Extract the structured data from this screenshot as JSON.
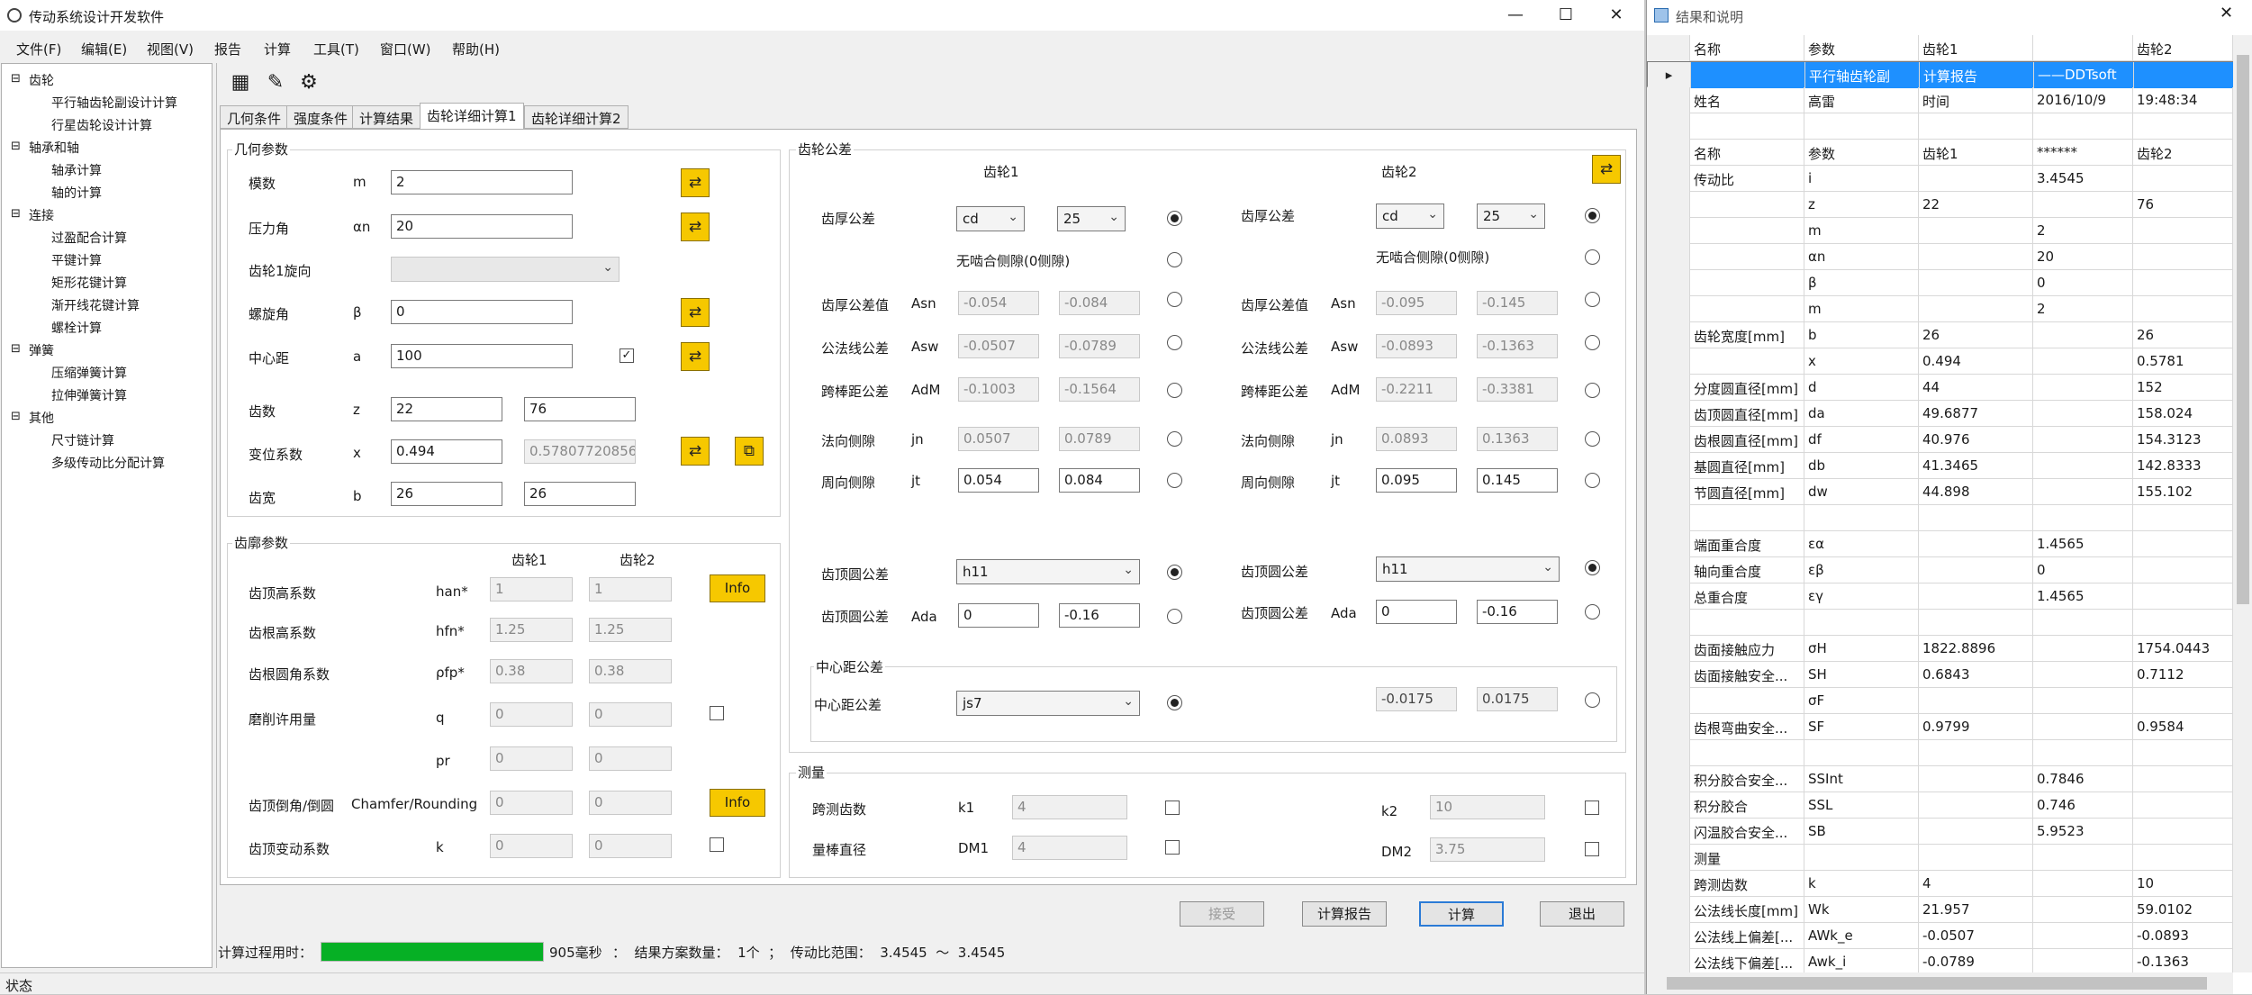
{
  "app": {
    "title": "传动系统设计开发软件"
  },
  "menu": [
    "文件(F)",
    "编辑(E)",
    "视图(V)",
    "报告",
    "计算",
    "工具(T)",
    "窗口(W)",
    "帮助(H)"
  ],
  "tree": {
    "groups": [
      {
        "label": "齿轮",
        "children": [
          "平行轴齿轮副设计计算",
          "行星齿轮设计计算"
        ]
      },
      {
        "label": "轴承和轴",
        "children": [
          "轴承计算",
          "轴的计算"
        ]
      },
      {
        "label": "连接",
        "children": [
          "过盈配合计算",
          "平键计算",
          "矩形花键计算",
          "渐开线花键计算",
          "螺栓计算"
        ]
      },
      {
        "label": "弹簧",
        "children": [
          "压缩弹簧计算",
          "拉伸弹簧计算"
        ]
      },
      {
        "label": "其他",
        "children": [
          "尺寸链计算",
          "多级传动比分配计算"
        ]
      }
    ]
  },
  "tabs": [
    "几何条件",
    "强度条件",
    "计算结果",
    "齿轮详细计算1",
    "齿轮详细计算2"
  ],
  "geom": {
    "title": "几何参数",
    "modulus": {
      "label": "模数",
      "sym": "m",
      "val": "2"
    },
    "pressure": {
      "label": "压力角",
      "sym": "αn",
      "val": "20"
    },
    "direction": {
      "label": "齿轮1旋向"
    },
    "helix": {
      "label": "螺旋角",
      "sym": "β",
      "val": "0"
    },
    "center": {
      "label": "中心距",
      "sym": "a",
      "val": "100"
    },
    "teeth": {
      "label": "齿数",
      "sym": "z",
      "v1": "22",
      "v2": "76"
    },
    "shift": {
      "label": "变位系数",
      "sym": "x",
      "v1": "0.494",
      "v2": "0.578077208561"
    },
    "width": {
      "label": "齿宽",
      "sym": "b",
      "v1": "26",
      "v2": "26"
    }
  },
  "profile": {
    "title": "齿廓参数",
    "h1": "齿轮1",
    "h2": "齿轮2",
    "rows": [
      {
        "label": "齿顶高系数",
        "sym": "han*",
        "v1": "1",
        "v2": "1"
      },
      {
        "label": "齿根高系数",
        "sym": "hfn*",
        "v1": "1.25",
        "v2": "1.25"
      },
      {
        "label": "齿根圆角系数",
        "sym": "ρfp*",
        "v1": "0.38",
        "v2": "0.38"
      },
      {
        "label": "磨削许用量",
        "sym": "q",
        "v1": "0",
        "v2": "0"
      },
      {
        "label": "",
        "sym": "pr",
        "v1": "0",
        "v2": "0"
      },
      {
        "label": "齿顶倒角/倒圆",
        "sym": "Chamfer/Rounding",
        "v1": "0",
        "v2": "0"
      },
      {
        "label": "齿顶变动系数",
        "sym": "k",
        "v1": "0",
        "v2": "0"
      }
    ],
    "info": "Info"
  },
  "tol": {
    "title": "齿轮公差",
    "h1": "齿轮1",
    "h2": "齿轮2",
    "thick_label": "齿厚公差",
    "g1": {
      "s1": "cd",
      "s2": "25"
    },
    "g2": {
      "s1": "cd",
      "s2": "25"
    },
    "nobacklash": "无啮合侧隙(0侧隙)",
    "rows": [
      {
        "label": "齿厚公差值",
        "sym": "Asn",
        "a1": "-0.054",
        "a2": "-0.084",
        "b1": "-0.095",
        "b2": "-0.145"
      },
      {
        "label": "公法线公差",
        "sym": "Asw",
        "a1": "-0.0507",
        "a2": "-0.0789",
        "b1": "-0.0893",
        "b2": "-0.1363"
      },
      {
        "label": "跨棒距公差",
        "sym": "AdM",
        "a1": "-0.1003",
        "a2": "-0.1564",
        "b1": "-0.2211",
        "b2": "-0.3381"
      },
      {
        "label": "法向侧隙",
        "sym": "jn",
        "a1": "0.0507",
        "a2": "0.0789",
        "b1": "0.0893",
        "b2": "0.1363"
      },
      {
        "label": "周向侧隙",
        "sym": "jt",
        "a1": "0.054",
        "a2": "0.084",
        "b1": "0.095",
        "b2": "0.145"
      }
    ],
    "tip_label": "齿顶圆公差",
    "tip_sel1": "h11",
    "tip_sel2": "h11",
    "tip_sym": "Ada",
    "tip1": {
      "a": "0",
      "b": "-0.16"
    },
    "tip2": {
      "a": "0",
      "b": "-0.16"
    },
    "center_title": "中心距公差",
    "center_label": "中心距公差",
    "center_sel": "js7",
    "center_v1": "-0.0175",
    "center_v2": "0.0175"
  },
  "measure": {
    "title": "测量",
    "span": {
      "label": "跨测齿数",
      "sym1": "k1",
      "v1": "4",
      "sym2": "k2",
      "v2": "10"
    },
    "ball": {
      "label": "量棒直径",
      "sym1": "DM1",
      "v1": "4",
      "sym2": "DM2",
      "v2": "3.75"
    }
  },
  "buttons": {
    "b0": "接受",
    "report": "计算报告",
    "calc": "计算",
    "exit": "退出"
  },
  "status": {
    "elapsed_label": "计算过程用时：",
    "progress": 1.0,
    "elapsed": "905毫秒",
    "count": "：  结果方案数量：  1个  ；  传动比范围：  3.4545  ～  3.4545",
    "bar": "状态"
  },
  "results": {
    "title": "结果和说明",
    "header": [
      "名称",
      "参数",
      "齿轮1",
      "",
      "齿轮2"
    ],
    "rows": [
      [
        "",
        "平行轴齿轮副",
        "计算报告",
        "——DDTsoft",
        ""
      ],
      [
        "姓名",
        "高雷",
        "时间",
        "2016/10/9",
        "19:48:34"
      ],
      [
        "",
        "",
        "",
        "",
        ""
      ],
      [
        "名称",
        "参数",
        "齿轮1",
        "******",
        "齿轮2"
      ],
      [
        "传动比",
        "i",
        "",
        "3.4545",
        ""
      ],
      [
        "",
        "z",
        "22",
        "",
        "76"
      ],
      [
        "",
        "m",
        "",
        "2",
        ""
      ],
      [
        "",
        "αn",
        "",
        "20",
        ""
      ],
      [
        "",
        "β",
        "",
        "0",
        ""
      ],
      [
        "",
        "m",
        "",
        "2",
        ""
      ],
      [
        "齿轮宽度[mm]",
        "b",
        "26",
        "",
        "26"
      ],
      [
        "",
        "x",
        "0.494",
        "",
        "0.5781"
      ],
      [
        "分度圆直径[mm]",
        "d",
        "44",
        "",
        "152"
      ],
      [
        "齿顶圆直径[mm]",
        "da",
        "49.6877",
        "",
        "158.024"
      ],
      [
        "齿根圆直径[mm]",
        "df",
        "40.976",
        "",
        "154.3123"
      ],
      [
        "基圆直径[mm]",
        "db",
        "41.3465",
        "",
        "142.8333"
      ],
      [
        "节圆直径[mm]",
        "dw",
        "44.898",
        "",
        "155.102"
      ],
      [
        "",
        "",
        "",
        "",
        ""
      ],
      [
        "端面重合度",
        "εα",
        "",
        "1.4565",
        ""
      ],
      [
        "轴向重合度",
        "εβ",
        "",
        "0",
        ""
      ],
      [
        "总重合度",
        "εγ",
        "",
        "1.4565",
        ""
      ],
      [
        "",
        "",
        "",
        "",
        ""
      ],
      [
        "齿面接触应力",
        "σH",
        "1822.8896",
        "",
        "1754.0443"
      ],
      [
        "齿面接触安全...",
        "SH",
        "0.6843",
        "",
        "0.7112"
      ],
      [
        "",
        "σF",
        "",
        "",
        ""
      ],
      [
        "齿根弯曲安全...",
        "SF",
        "0.9799",
        "",
        "0.9584"
      ],
      [
        "",
        "",
        "",
        "",
        ""
      ],
      [
        "积分胶合安全...",
        "SSInt",
        "",
        "0.7846",
        ""
      ],
      [
        "积分胶合",
        "SSL",
        "",
        "0.746",
        ""
      ],
      [
        "闪温胶合安全...",
        "SB",
        "",
        "5.9523",
        ""
      ],
      [
        "测量",
        "",
        "",
        "",
        ""
      ],
      [
        "跨测齿数",
        "k",
        "4",
        "",
        "10"
      ],
      [
        "公法线长度[mm]",
        "Wk",
        "21.957",
        "",
        "59.0102"
      ],
      [
        "公法线上偏差[...",
        "AWk_e",
        "-0.0507",
        "",
        "-0.0893"
      ],
      [
        "公法线下偏差[...",
        "Awk_i",
        "-0.0789",
        "",
        "-0.1363"
      ]
    ]
  }
}
